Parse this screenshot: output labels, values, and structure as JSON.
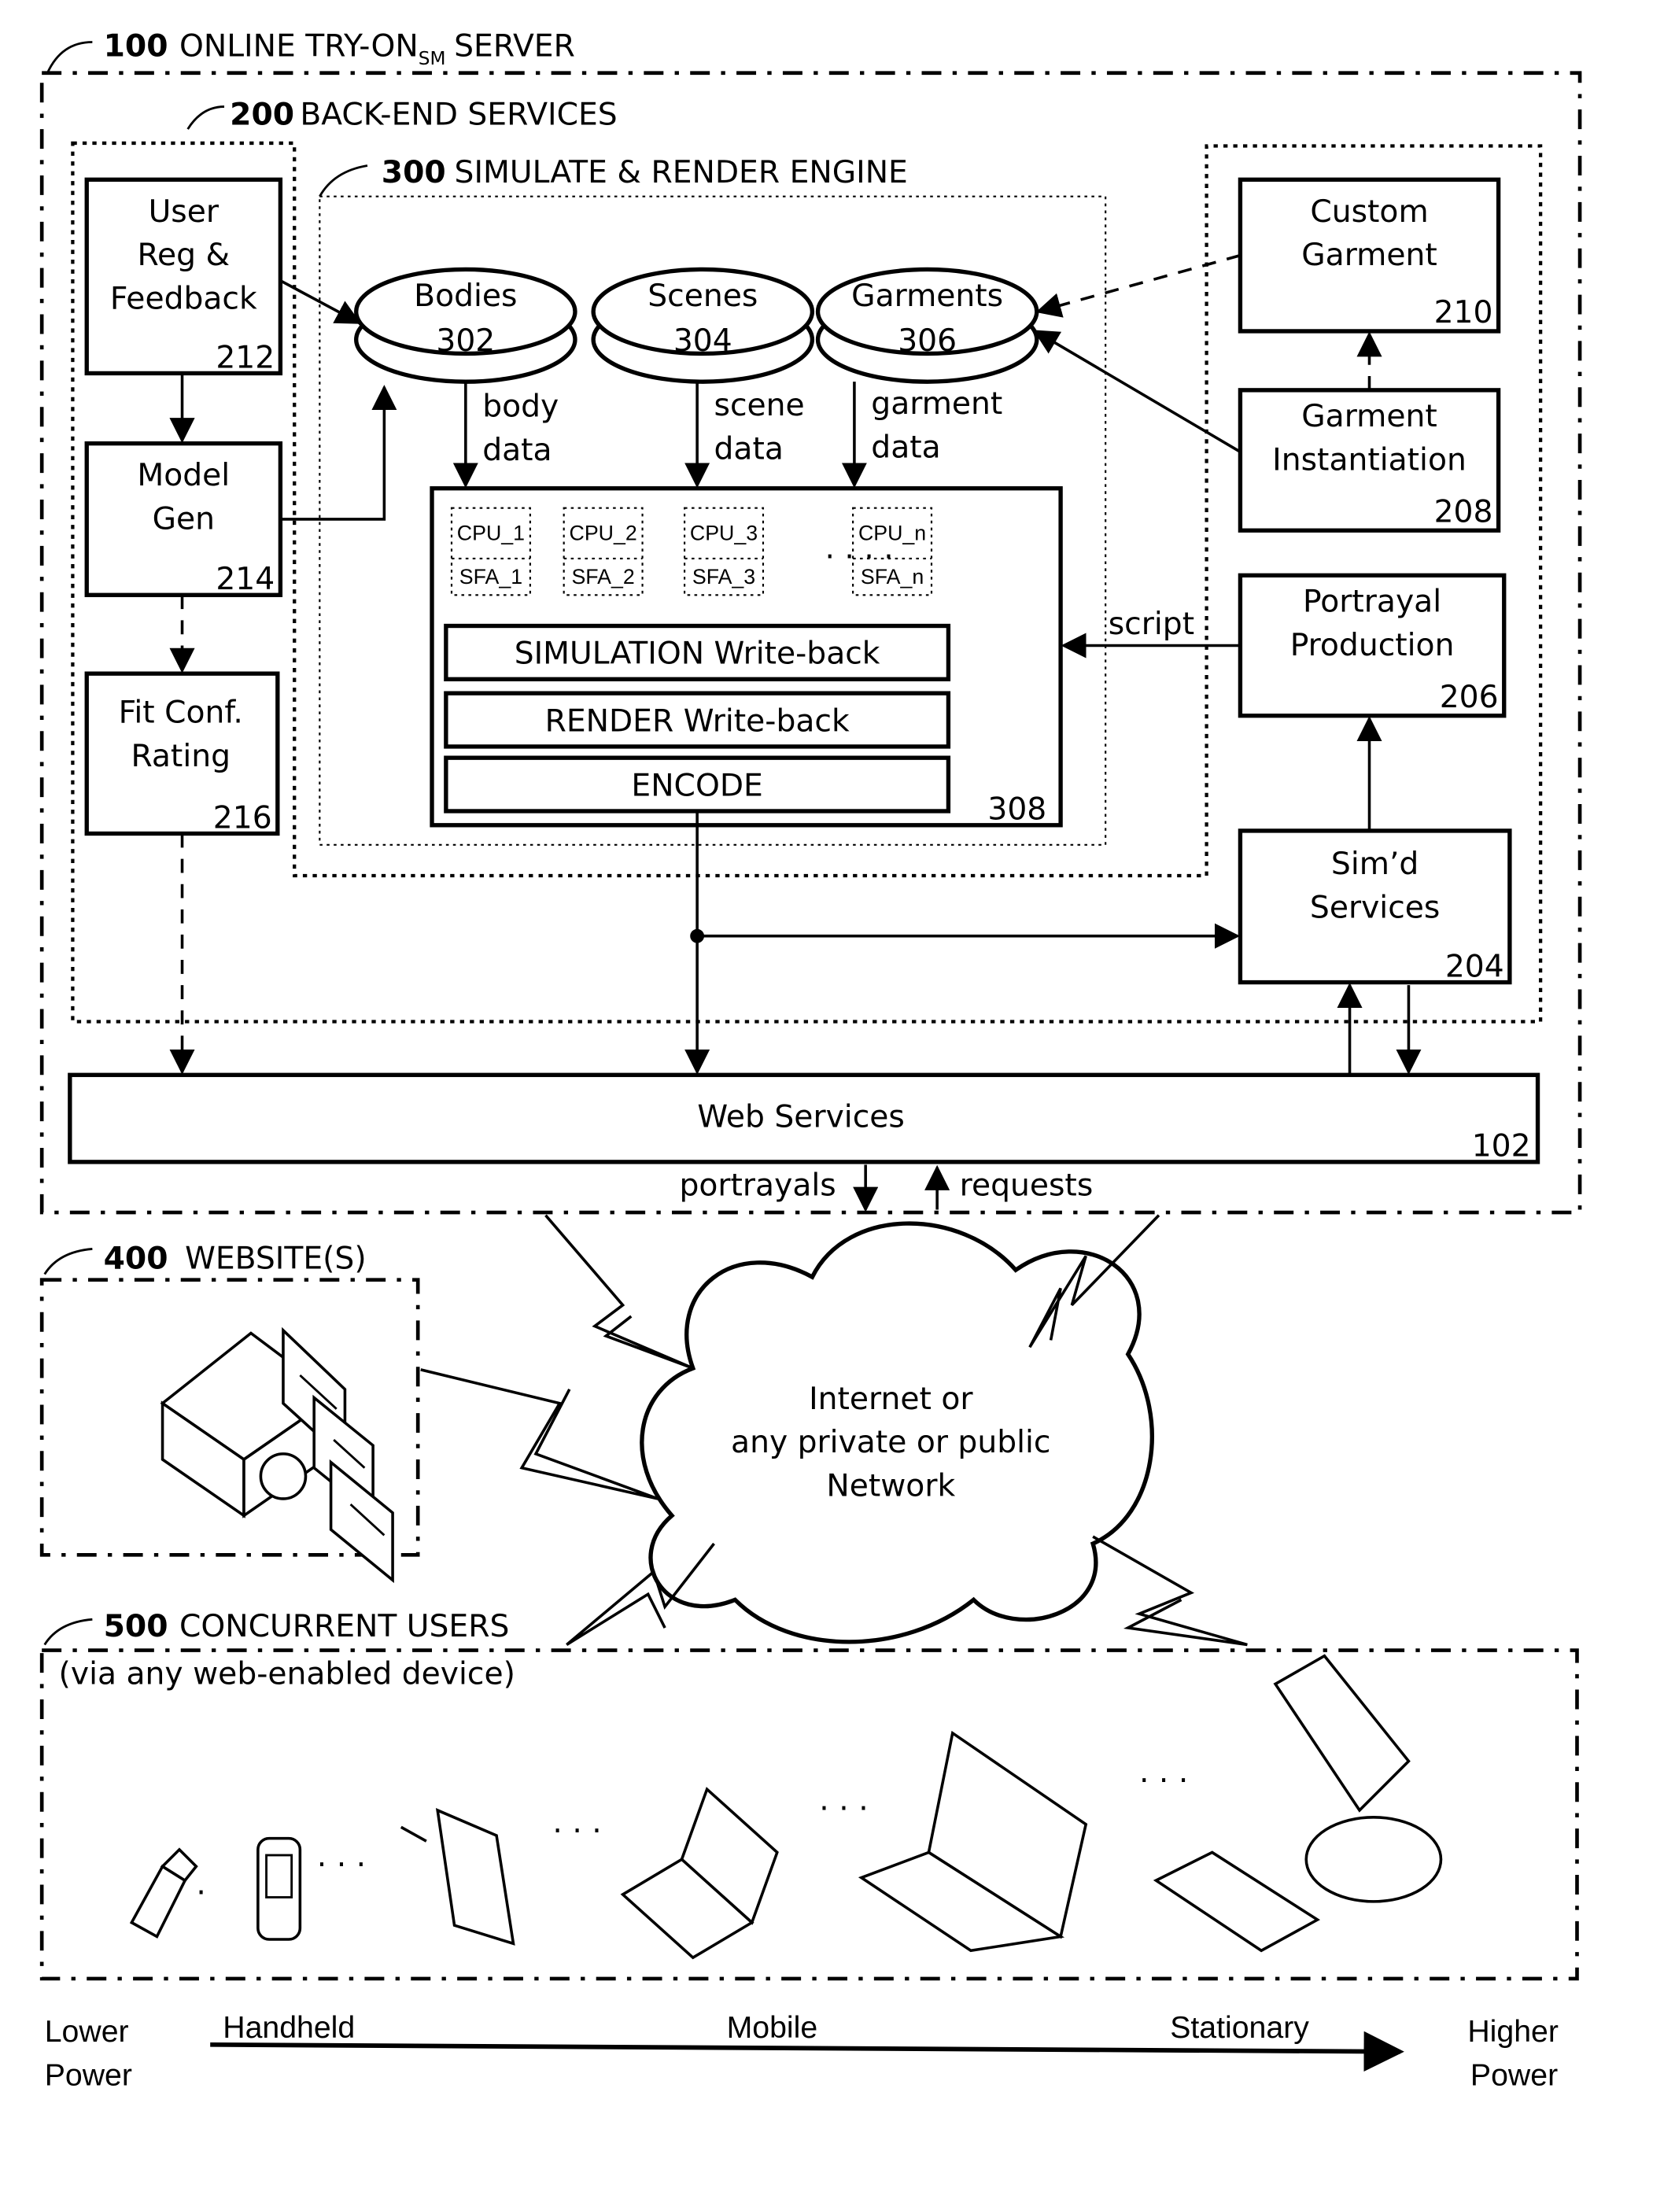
{
  "server": {
    "number": "100",
    "title_main": "ONLINE TRY-ON",
    "title_sub": "SM",
    "title_end": "SERVER"
  },
  "backend": {
    "number": "200",
    "title": "BACK-END SERVICES"
  },
  "engine": {
    "number": "300",
    "title": "SIMULATE & RENDER ENGINE"
  },
  "left_boxes": [
    {
      "lines": [
        "User",
        "Reg &",
        "Feedback"
      ],
      "ref": "212"
    },
    {
      "lines": [
        "Model",
        "Gen"
      ],
      "ref": "214"
    },
    {
      "lines": [
        "Fit Conf.",
        "Rating"
      ],
      "ref": "216"
    }
  ],
  "right_boxes": [
    {
      "lines": [
        "Custom",
        "Garment"
      ],
      "ref": "210"
    },
    {
      "lines": [
        "Garment",
        "Instantiation"
      ],
      "ref": "208"
    },
    {
      "lines": [
        "Portrayal",
        "Production"
      ],
      "ref": "206"
    },
    {
      "lines": [
        "Sim’d",
        "Services"
      ],
      "ref": "204"
    }
  ],
  "databases": [
    {
      "name": "Bodies",
      "ref": "302",
      "flow": [
        "body",
        "data"
      ]
    },
    {
      "name": "Scenes",
      "ref": "304",
      "flow": [
        "scene",
        "data"
      ]
    },
    {
      "name": "Garments",
      "ref": "306",
      "flow": [
        "garment",
        "data"
      ]
    }
  ],
  "processors": [
    {
      "cpu": "CPU_1",
      "sfa": "SFA_1"
    },
    {
      "cpu": "CPU_2",
      "sfa": "SFA_2"
    },
    {
      "cpu": "CPU_3",
      "sfa": "SFA_3"
    },
    {
      "cpu": "CPU_n",
      "sfa": "SFA_n"
    }
  ],
  "pipeline": {
    "ref": "308",
    "stages": [
      "SIMULATION Write-back",
      "RENDER Write-back",
      "ENCODE"
    ],
    "script_label": "script"
  },
  "web_services": {
    "label": "Web Services",
    "ref": "102",
    "out_label": "portrayals",
    "in_label": "requests"
  },
  "network": {
    "lines": [
      "Internet or",
      "any private or public",
      "Network"
    ]
  },
  "websites": {
    "number": "400",
    "title": "WEBSITE(S)"
  },
  "users": {
    "number": "500",
    "title": "CONCURRENT USERS",
    "subtitle": "(via any web-enabled device)",
    "devices": [
      "flip-phone",
      "pda",
      "tablet",
      "small-laptop",
      "large-laptop",
      "desktop"
    ]
  },
  "power_axis": {
    "low": [
      "Lower",
      "Power"
    ],
    "high": [
      "Higher",
      "Power"
    ],
    "categories": [
      "Handheld",
      "Mobile",
      "Stationary"
    ]
  }
}
